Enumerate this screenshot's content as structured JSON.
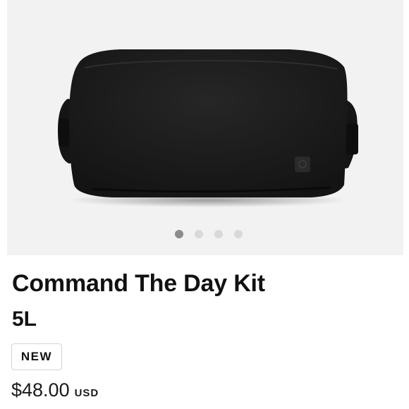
{
  "gallery": {
    "image_alt": "Command The Day Kit 5L black travel bag",
    "dots": [
      {
        "active": true
      },
      {
        "active": false
      },
      {
        "active": false
      },
      {
        "active": false
      }
    ]
  },
  "product": {
    "name": "Command The Day Kit",
    "size": "5L",
    "badge": "NEW",
    "price": "$48.00",
    "currency": "USD"
  },
  "colors": {
    "gallery_bg": "#f2f2f2",
    "bag": "#1c1c1c",
    "dot_active": "#8c8c8c",
    "dot_inactive": "#d9d9d9",
    "text": "#111111"
  }
}
